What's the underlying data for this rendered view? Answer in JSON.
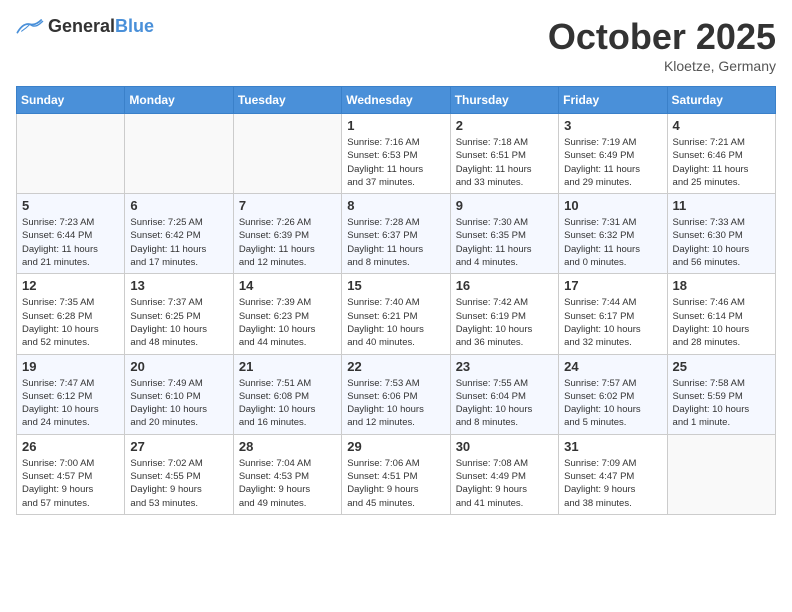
{
  "header": {
    "logo": {
      "general": "General",
      "blue": "Blue"
    },
    "title": "October 2025",
    "location": "Kloetze, Germany"
  },
  "weekdays": [
    "Sunday",
    "Monday",
    "Tuesday",
    "Wednesday",
    "Thursday",
    "Friday",
    "Saturday"
  ],
  "weeks": [
    [
      {
        "day": "",
        "info": ""
      },
      {
        "day": "",
        "info": ""
      },
      {
        "day": "",
        "info": ""
      },
      {
        "day": "1",
        "info": "Sunrise: 7:16 AM\nSunset: 6:53 PM\nDaylight: 11 hours\nand 37 minutes."
      },
      {
        "day": "2",
        "info": "Sunrise: 7:18 AM\nSunset: 6:51 PM\nDaylight: 11 hours\nand 33 minutes."
      },
      {
        "day": "3",
        "info": "Sunrise: 7:19 AM\nSunset: 6:49 PM\nDaylight: 11 hours\nand 29 minutes."
      },
      {
        "day": "4",
        "info": "Sunrise: 7:21 AM\nSunset: 6:46 PM\nDaylight: 11 hours\nand 25 minutes."
      }
    ],
    [
      {
        "day": "5",
        "info": "Sunrise: 7:23 AM\nSunset: 6:44 PM\nDaylight: 11 hours\nand 21 minutes."
      },
      {
        "day": "6",
        "info": "Sunrise: 7:25 AM\nSunset: 6:42 PM\nDaylight: 11 hours\nand 17 minutes."
      },
      {
        "day": "7",
        "info": "Sunrise: 7:26 AM\nSunset: 6:39 PM\nDaylight: 11 hours\nand 12 minutes."
      },
      {
        "day": "8",
        "info": "Sunrise: 7:28 AM\nSunset: 6:37 PM\nDaylight: 11 hours\nand 8 minutes."
      },
      {
        "day": "9",
        "info": "Sunrise: 7:30 AM\nSunset: 6:35 PM\nDaylight: 11 hours\nand 4 minutes."
      },
      {
        "day": "10",
        "info": "Sunrise: 7:31 AM\nSunset: 6:32 PM\nDaylight: 11 hours\nand 0 minutes."
      },
      {
        "day": "11",
        "info": "Sunrise: 7:33 AM\nSunset: 6:30 PM\nDaylight: 10 hours\nand 56 minutes."
      }
    ],
    [
      {
        "day": "12",
        "info": "Sunrise: 7:35 AM\nSunset: 6:28 PM\nDaylight: 10 hours\nand 52 minutes."
      },
      {
        "day": "13",
        "info": "Sunrise: 7:37 AM\nSunset: 6:25 PM\nDaylight: 10 hours\nand 48 minutes."
      },
      {
        "day": "14",
        "info": "Sunrise: 7:39 AM\nSunset: 6:23 PM\nDaylight: 10 hours\nand 44 minutes."
      },
      {
        "day": "15",
        "info": "Sunrise: 7:40 AM\nSunset: 6:21 PM\nDaylight: 10 hours\nand 40 minutes."
      },
      {
        "day": "16",
        "info": "Sunrise: 7:42 AM\nSunset: 6:19 PM\nDaylight: 10 hours\nand 36 minutes."
      },
      {
        "day": "17",
        "info": "Sunrise: 7:44 AM\nSunset: 6:17 PM\nDaylight: 10 hours\nand 32 minutes."
      },
      {
        "day": "18",
        "info": "Sunrise: 7:46 AM\nSunset: 6:14 PM\nDaylight: 10 hours\nand 28 minutes."
      }
    ],
    [
      {
        "day": "19",
        "info": "Sunrise: 7:47 AM\nSunset: 6:12 PM\nDaylight: 10 hours\nand 24 minutes."
      },
      {
        "day": "20",
        "info": "Sunrise: 7:49 AM\nSunset: 6:10 PM\nDaylight: 10 hours\nand 20 minutes."
      },
      {
        "day": "21",
        "info": "Sunrise: 7:51 AM\nSunset: 6:08 PM\nDaylight: 10 hours\nand 16 minutes."
      },
      {
        "day": "22",
        "info": "Sunrise: 7:53 AM\nSunset: 6:06 PM\nDaylight: 10 hours\nand 12 minutes."
      },
      {
        "day": "23",
        "info": "Sunrise: 7:55 AM\nSunset: 6:04 PM\nDaylight: 10 hours\nand 8 minutes."
      },
      {
        "day": "24",
        "info": "Sunrise: 7:57 AM\nSunset: 6:02 PM\nDaylight: 10 hours\nand 5 minutes."
      },
      {
        "day": "25",
        "info": "Sunrise: 7:58 AM\nSunset: 5:59 PM\nDaylight: 10 hours\nand 1 minute."
      }
    ],
    [
      {
        "day": "26",
        "info": "Sunrise: 7:00 AM\nSunset: 4:57 PM\nDaylight: 9 hours\nand 57 minutes."
      },
      {
        "day": "27",
        "info": "Sunrise: 7:02 AM\nSunset: 4:55 PM\nDaylight: 9 hours\nand 53 minutes."
      },
      {
        "day": "28",
        "info": "Sunrise: 7:04 AM\nSunset: 4:53 PM\nDaylight: 9 hours\nand 49 minutes."
      },
      {
        "day": "29",
        "info": "Sunrise: 7:06 AM\nSunset: 4:51 PM\nDaylight: 9 hours\nand 45 minutes."
      },
      {
        "day": "30",
        "info": "Sunrise: 7:08 AM\nSunset: 4:49 PM\nDaylight: 9 hours\nand 41 minutes."
      },
      {
        "day": "31",
        "info": "Sunrise: 7:09 AM\nSunset: 4:47 PM\nDaylight: 9 hours\nand 38 minutes."
      },
      {
        "day": "",
        "info": ""
      }
    ]
  ]
}
